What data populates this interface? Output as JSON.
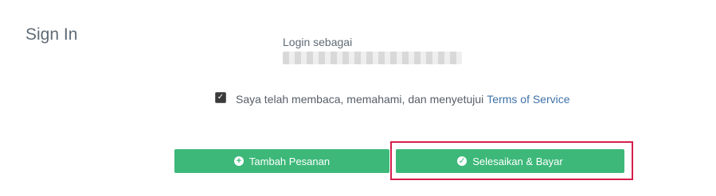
{
  "page": {
    "title": "Sign In"
  },
  "login": {
    "label": "Login sebagai",
    "value_redacted": true
  },
  "terms": {
    "checked": true,
    "text": "Saya telah membaca, memahami, dan menyetujui",
    "link_label": "Terms of Service"
  },
  "actions": {
    "add_order_label": "Tambah Pesanan",
    "add_order_icon": "plus-circle-icon",
    "finish_pay_label": "Selesaikan & Bayar",
    "finish_pay_icon": "check-circle-icon"
  },
  "colors": {
    "button_green": "#3db879",
    "link_blue": "#3f72a8",
    "highlight_red": "#d51e4d"
  }
}
